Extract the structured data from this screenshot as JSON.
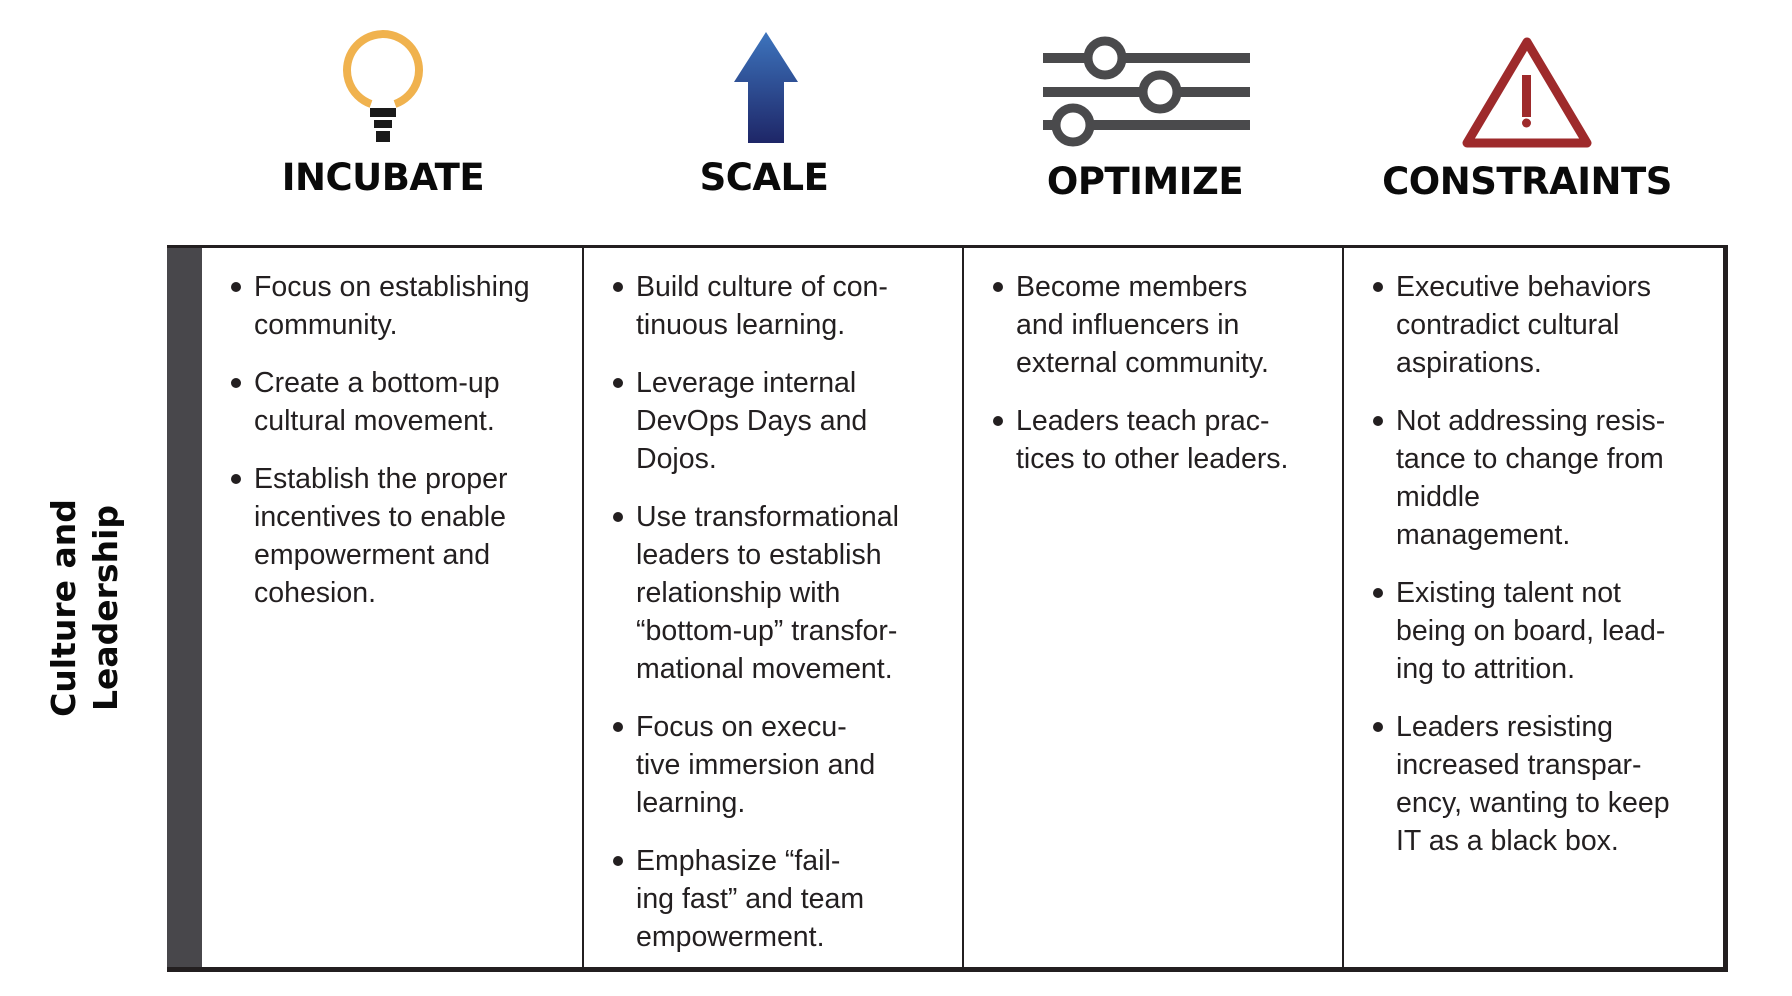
{
  "headers": [
    {
      "key": "incubate",
      "title": "INCUBATE",
      "icon": "lightbulb-icon",
      "icon_color": "#f0b24e"
    },
    {
      "key": "scale",
      "title": "SCALE",
      "icon": "up-arrow-icon",
      "icon_color": "#2d4f97"
    },
    {
      "key": "optimize",
      "title": "OPTIMIZE",
      "icon": "sliders-icon",
      "icon_color": "#4a4a4c"
    },
    {
      "key": "constraints",
      "title": "CONSTRAINTS",
      "icon": "warning-triangle-icon",
      "icon_color": "#9e2a2b"
    }
  ],
  "row": {
    "label_lines": [
      "Culture and",
      "Leadership"
    ],
    "bar_color": "#48474b"
  },
  "columns": {
    "incubate": [
      [
        "Focus on establishing",
        "community."
      ],
      [
        "Create a bottom-up",
        "cultural movement."
      ],
      [
        "Establish the proper",
        "incentives to enable",
        "empowerment and",
        "cohesion."
      ]
    ],
    "scale": [
      [
        "Build culture of con-",
        "tinuous learning."
      ],
      [
        "Leverage internal",
        "DevOps Days and",
        "Dojos."
      ],
      [
        "Use transformational",
        "leaders to establish",
        "relationship with",
        "“bottom-up” transfor-",
        "mational movement."
      ],
      [
        "Focus on execu-",
        "tive immersion and",
        "learning."
      ],
      [
        "Emphasize “fail-",
        "ing fast” and team",
        "empowerment."
      ]
    ],
    "optimize": [
      [
        "Become members",
        "and influencers in",
        "external community."
      ],
      [
        "Leaders teach prac-",
        "tices to other leaders."
      ]
    ],
    "constraints": [
      [
        "Executive behaviors",
        "contradict cultural",
        "aspirations."
      ],
      [
        "Not addressing resis-",
        "tance to change from",
        "middle",
        "management."
      ],
      [
        "Existing talent not",
        "being on board, lead-",
        "ing to attrition."
      ],
      [
        "Leaders resisting",
        "increased transpar-",
        "ency, wanting to keep",
        "IT as a black box."
      ]
    ]
  }
}
